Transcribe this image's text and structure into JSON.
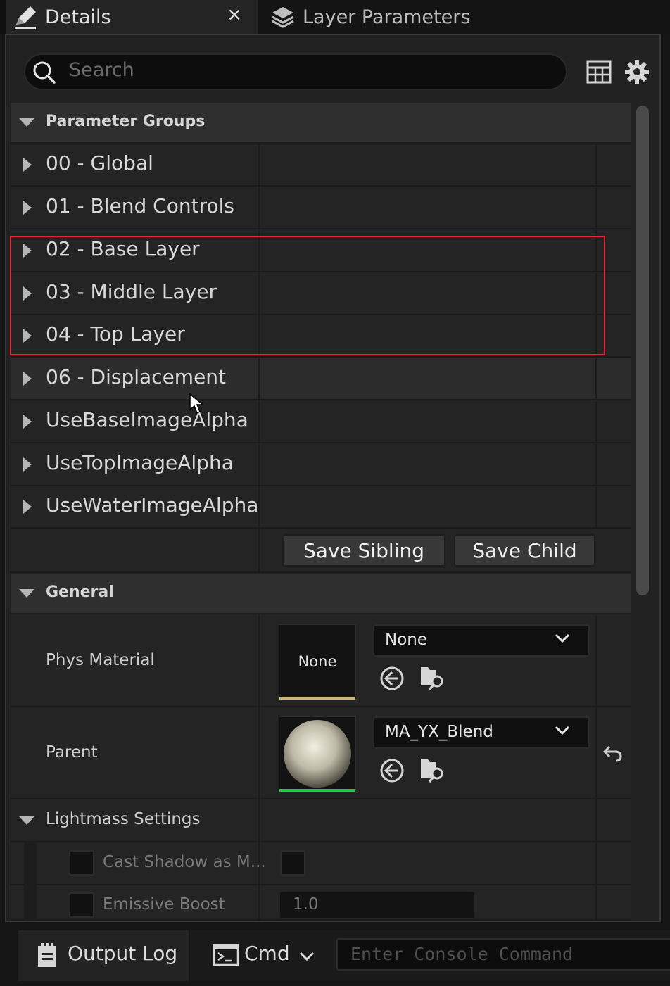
{
  "tabs": {
    "details": "Details",
    "close": "×",
    "layer_parameters": "Layer Parameters"
  },
  "search": {
    "placeholder": "Search"
  },
  "parameter_groups": {
    "header": "Parameter Groups",
    "items": [
      "00 - Global",
      "01 - Blend Controls",
      "02 - Base Layer",
      "03 - Middle Layer",
      "04 - Top Layer",
      "06 - Displacement",
      "UseBaseImageAlpha",
      "UseTopImageAlpha",
      "UseWaterImageAlpha"
    ],
    "save_sibling": "Save Sibling",
    "save_child": "Save Child"
  },
  "general": {
    "header": "General",
    "phys_material": {
      "label": "Phys Material",
      "thumb_text": "None",
      "value": "None"
    },
    "parent": {
      "label": "Parent",
      "value": "MA_YX_Blend"
    },
    "lightmass": {
      "header": "Lightmass Settings",
      "cast_shadow": "Cast Shadow as M...",
      "emissive_boost": "Emissive Boost",
      "emissive_boost_value": "1.0"
    }
  },
  "bottom": {
    "output_log": "Output Log",
    "cmd": "Cmd",
    "console_placeholder": "Enter Console Command"
  },
  "colors": {
    "highlight": "#e8263a",
    "phys_thumb_bar": "#c8b67a",
    "parent_thumb_bar": "#2ec44a"
  }
}
